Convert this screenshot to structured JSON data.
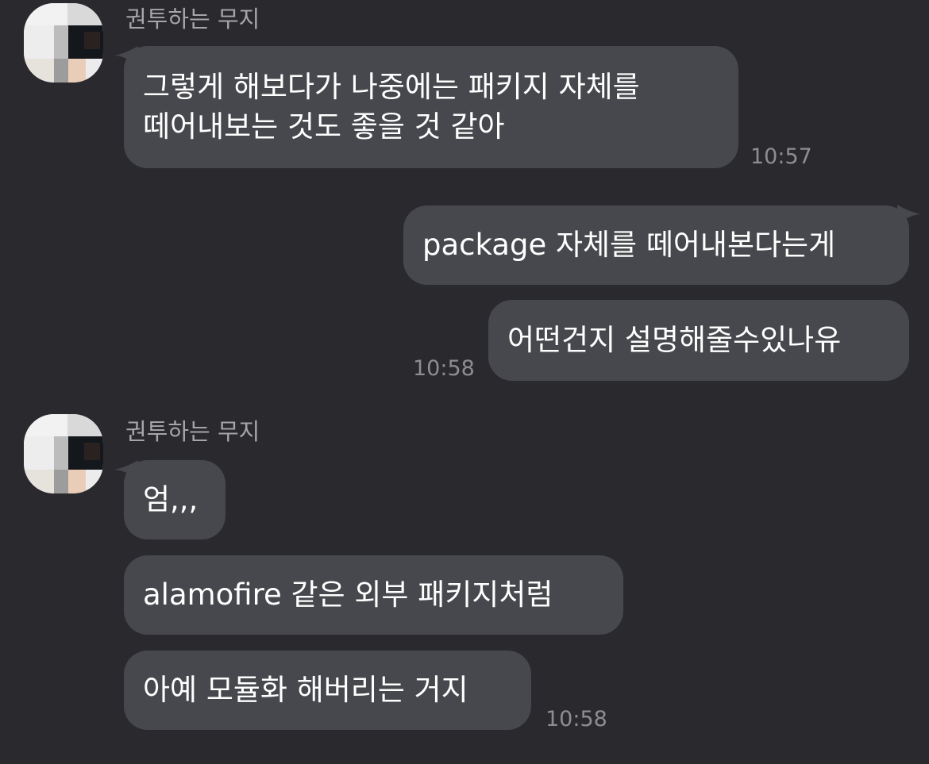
{
  "colors": {
    "background": "#2a2a2e",
    "bubble": "#47484d",
    "bubble_text": "#ffffff",
    "sender_text": "#a6a6aa",
    "time_text": "#8d8d92"
  },
  "messages": {
    "group1": {
      "sender": "권투하는 무지",
      "avatar_icon": "pixelated-profile-photo",
      "bubble1": {
        "line1": "그렇게 해보다가 나중에는 패키지 자체를",
        "line2": "떼어내보는 것도 좋을 것 같아"
      },
      "time": "10:57"
    },
    "group2": {
      "bubble1": "package 자체를 떼어내본다는게",
      "bubble2": "어떤건지 설명해줄수있나유",
      "time": "10:58"
    },
    "group3": {
      "sender": "권투하는 무지",
      "avatar_icon": "pixelated-profile-photo",
      "bubble1": "엄,,,",
      "bubble2": "alamofire 같은 외부 패키지처럼",
      "bubble3": "아예 모듈화 해버리는 거지",
      "time": "10:58"
    }
  }
}
